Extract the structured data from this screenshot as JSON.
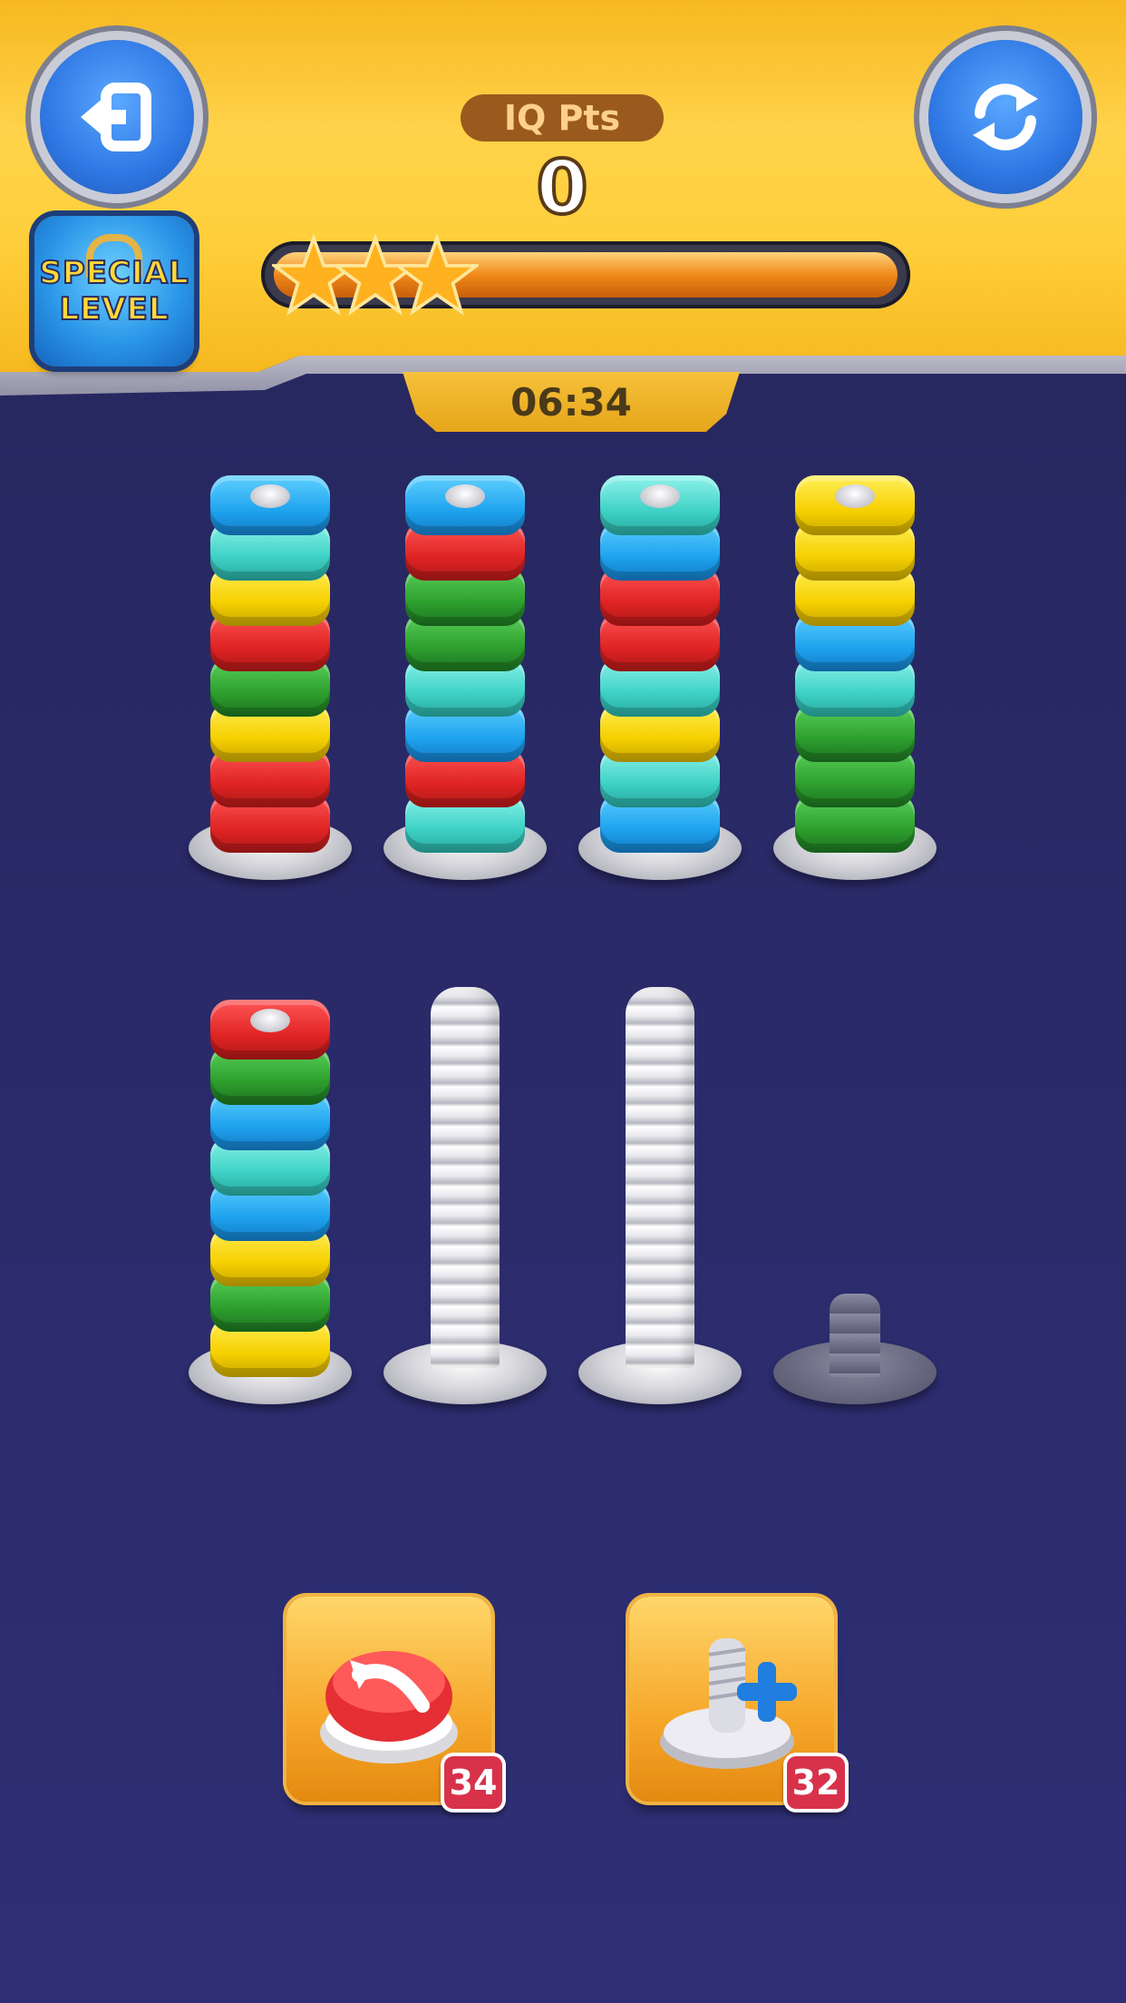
{
  "header": {
    "exit_icon": "exit-icon",
    "restart_icon": "restart-icon",
    "special_level": {
      "line1": "SPECIAL",
      "line2": "LEVEL"
    },
    "iq_label": "IQ Pts",
    "iq_value": "0",
    "progress_fraction": 0.0,
    "stars": 3
  },
  "timer": "06:34",
  "colors": {
    "red": "#e02424",
    "blue": "#1fa3ee",
    "teal": "#3fd2c6",
    "yellow": "#f6d000",
    "green": "#2ea02e",
    "background": "#2b2b6c",
    "header": "#ffcf3b"
  },
  "board": {
    "row1": [
      [
        "blue",
        "teal",
        "yellow",
        "red",
        "green",
        "yellow",
        "red",
        "red"
      ],
      [
        "blue",
        "red",
        "green",
        "green",
        "teal",
        "blue",
        "red",
        "teal"
      ],
      [
        "teal",
        "blue",
        "red",
        "red",
        "teal",
        "yellow",
        "teal",
        "blue"
      ],
      [
        "yellow",
        "yellow",
        "yellow",
        "blue",
        "teal",
        "green",
        "green",
        "green"
      ]
    ],
    "row2": [
      [
        "red",
        "green",
        "blue",
        "teal",
        "blue",
        "yellow",
        "green",
        "yellow"
      ],
      [],
      [],
      "locked"
    ]
  },
  "powerups": {
    "undo": {
      "icon": "undo-button-icon",
      "count": "34"
    },
    "add_screw": {
      "icon": "add-screw-icon",
      "count": "32"
    }
  }
}
